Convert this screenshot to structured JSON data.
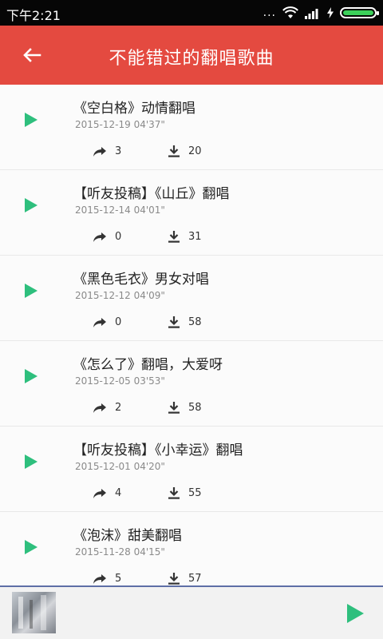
{
  "status_bar": {
    "time": "下午2:21",
    "dots": "...",
    "battery_level": 1.0,
    "colors": {
      "battery": "#3cd05a"
    }
  },
  "header": {
    "title": "不能错过的翻唱歌曲",
    "back_icon": "arrow-left-icon",
    "color": "#e44a40"
  },
  "songs": [
    {
      "title": "《空白格》动情翻唱",
      "date": "2015-12-19",
      "duration": "04'37\"",
      "shares": "3",
      "downloads": "20"
    },
    {
      "title": "【听友投稿】《山丘》翻唱",
      "date": "2015-12-14",
      "duration": "04'01\"",
      "shares": "0",
      "downloads": "31"
    },
    {
      "title": "《黑色毛衣》男女对唱",
      "date": "2015-12-12",
      "duration": "04'09\"",
      "shares": "0",
      "downloads": "58"
    },
    {
      "title": "《怎么了》翻唱，大爱呀",
      "date": "2015-12-05",
      "duration": "03'53\"",
      "shares": "2",
      "downloads": "58"
    },
    {
      "title": "【听友投稿】《小幸运》翻唱",
      "date": "2015-12-01",
      "duration": "04'20\"",
      "shares": "4",
      "downloads": "55"
    },
    {
      "title": "《泡沫》甜美翻唱",
      "date": "2015-11-28",
      "duration": "04'15\"",
      "shares": "5",
      "downloads": "57"
    }
  ],
  "icons": {
    "play": "play-icon",
    "share": "share-arrow-icon",
    "download": "download-icon"
  },
  "colors": {
    "play_green": "#2ebf7d",
    "stat_icon": "#333333"
  },
  "player": {
    "play_icon": "play-icon",
    "cover": "album-cover"
  }
}
